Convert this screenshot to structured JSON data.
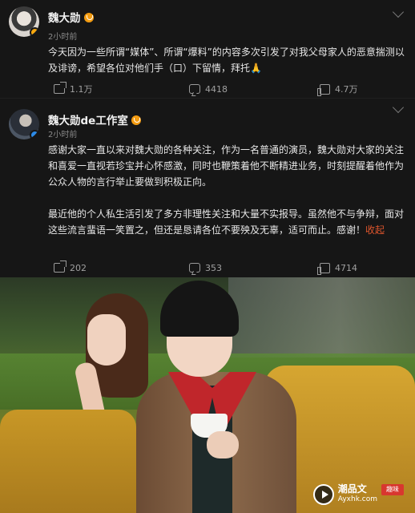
{
  "posts": [
    {
      "name": "魏大勋",
      "time": "2小时前",
      "text": "今天因为一些所谓“媒体”、所谓“爆料”的内容多次引发了对我父母家人的恶意揣测以及诽谤，希望各位对他们手（口）下留情，拜托🙏",
      "shares": "1.1万",
      "comments": "4418",
      "likes": "4.7万"
    },
    {
      "name": "魏大勋de工作室",
      "time": "2小时前",
      "paragraph1": "感谢大家一直以来对魏大勋的各种关注，作为一名普通的演员，魏大勋对大家的关注和喜爱一直视若珍宝并心怀感激，同时也鞭策着他不断精进业务，时刻提醒着他作为公众人物的言行举止要做到积极正向。",
      "paragraph2": "最近他的个人私生活引发了多方非理性关注和大量不实报导。虽然他不与争辩，面对这些流言蜚语一笑置之，但还是恳请各位不要殃及无辜，适可而止。感谢！",
      "more": "收起",
      "shares": "202",
      "comments": "353",
      "likes": "4714"
    }
  ],
  "watermark": {
    "title": "潮品文",
    "url": "Ayxhk.com",
    "seal": "趣味"
  },
  "icons": [
    "more-chevron-icon",
    "share-icon",
    "comment-icon",
    "like-icon",
    "play-icon"
  ],
  "colors": {
    "background": "#161616",
    "accent": "#e0562d",
    "badge": "#f39c12"
  }
}
